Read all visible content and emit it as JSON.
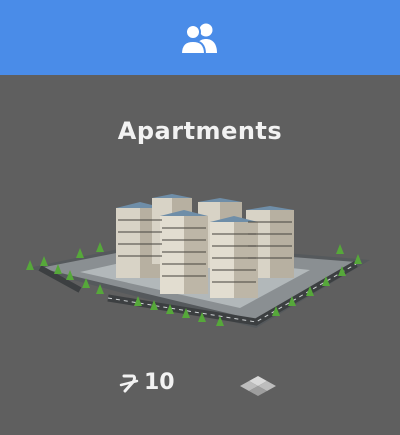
{
  "header": {
    "icon": "residents-icon",
    "color": "#4a8ce8"
  },
  "building": {
    "name": "Apartments",
    "cost": "10",
    "cost_icon": "currency-icon",
    "size_icon": "tile-size-icon"
  },
  "colors": {
    "background": "#5f5f5f",
    "text": "#f2f2f2"
  }
}
